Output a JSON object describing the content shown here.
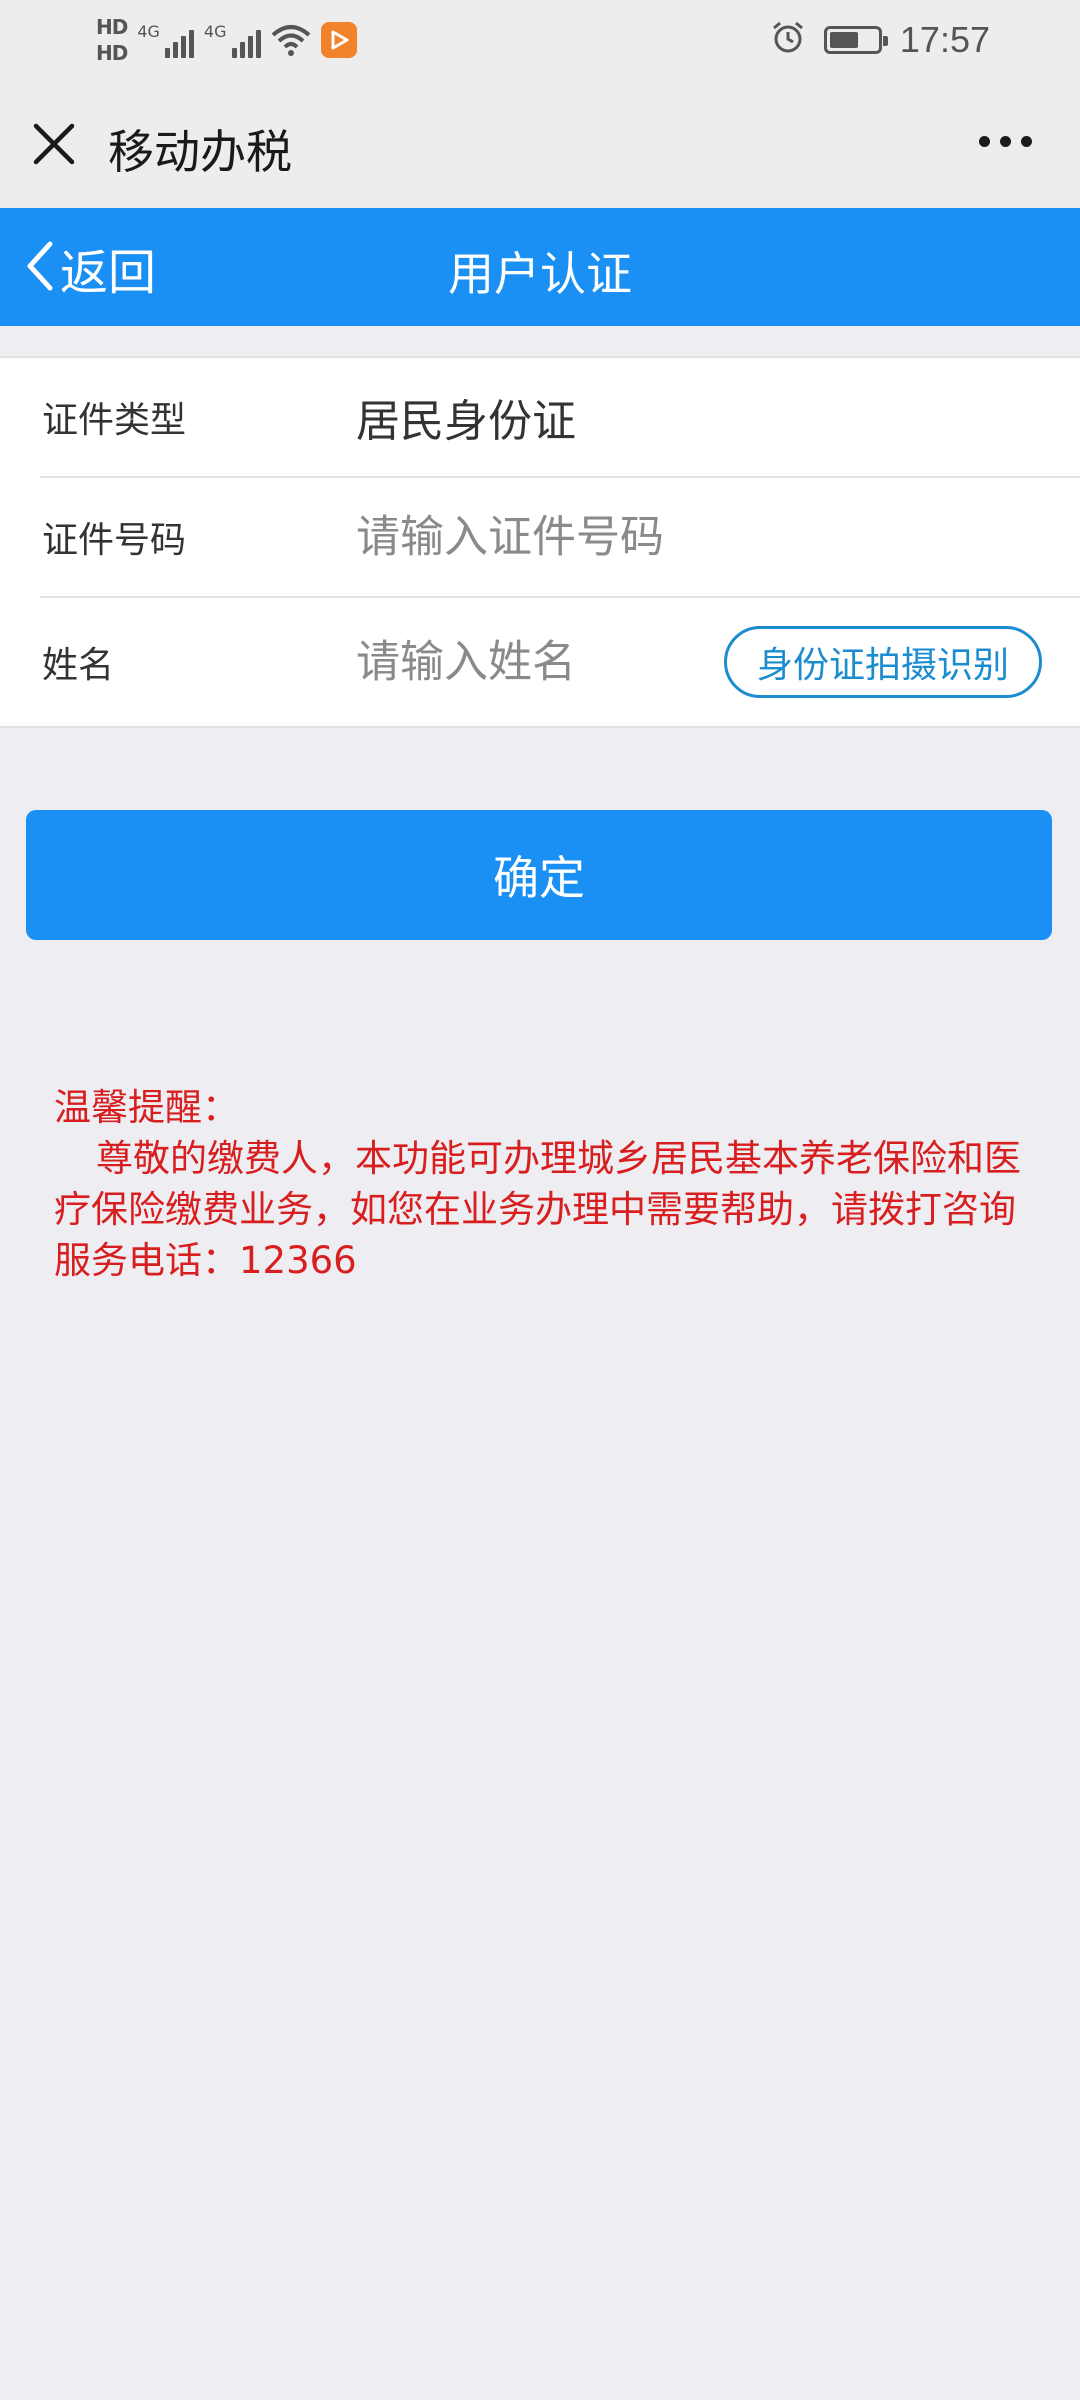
{
  "status_bar": {
    "hd1": "HD",
    "hd2": "HD",
    "sim1_label": "4G",
    "sim2_label": "4G",
    "time": "17:57",
    "battery_level": 0.6,
    "icons": [
      "signal-icon",
      "wifi-icon",
      "app-badge-icon",
      "alarm-icon",
      "battery-icon"
    ]
  },
  "title_bar": {
    "title": "移动办税",
    "close_icon": "close-icon",
    "more_icon": "more-icon"
  },
  "nav": {
    "back_label": "返回",
    "page_title": "用户认证"
  },
  "form": {
    "id_type": {
      "label": "证件类型",
      "value": "居民身份证"
    },
    "id_number": {
      "label": "证件号码",
      "placeholder": "请输入证件号码",
      "value": ""
    },
    "name": {
      "label": "姓名",
      "placeholder": "请输入姓名",
      "value": "",
      "scan_button": "身份证拍摄识别"
    }
  },
  "confirm_label": "确定",
  "notice": {
    "title": "温馨提醒：",
    "body": "尊敬的缴费人，本功能可办理城乡居民基本养老保险和医疗保险缴费业务，如您在业务办理中需要帮助，请拨打咨询服务电话：12366"
  },
  "colors": {
    "primary": "#1a8ff4",
    "notice": "#d81e1e",
    "background": "#ededf2"
  }
}
